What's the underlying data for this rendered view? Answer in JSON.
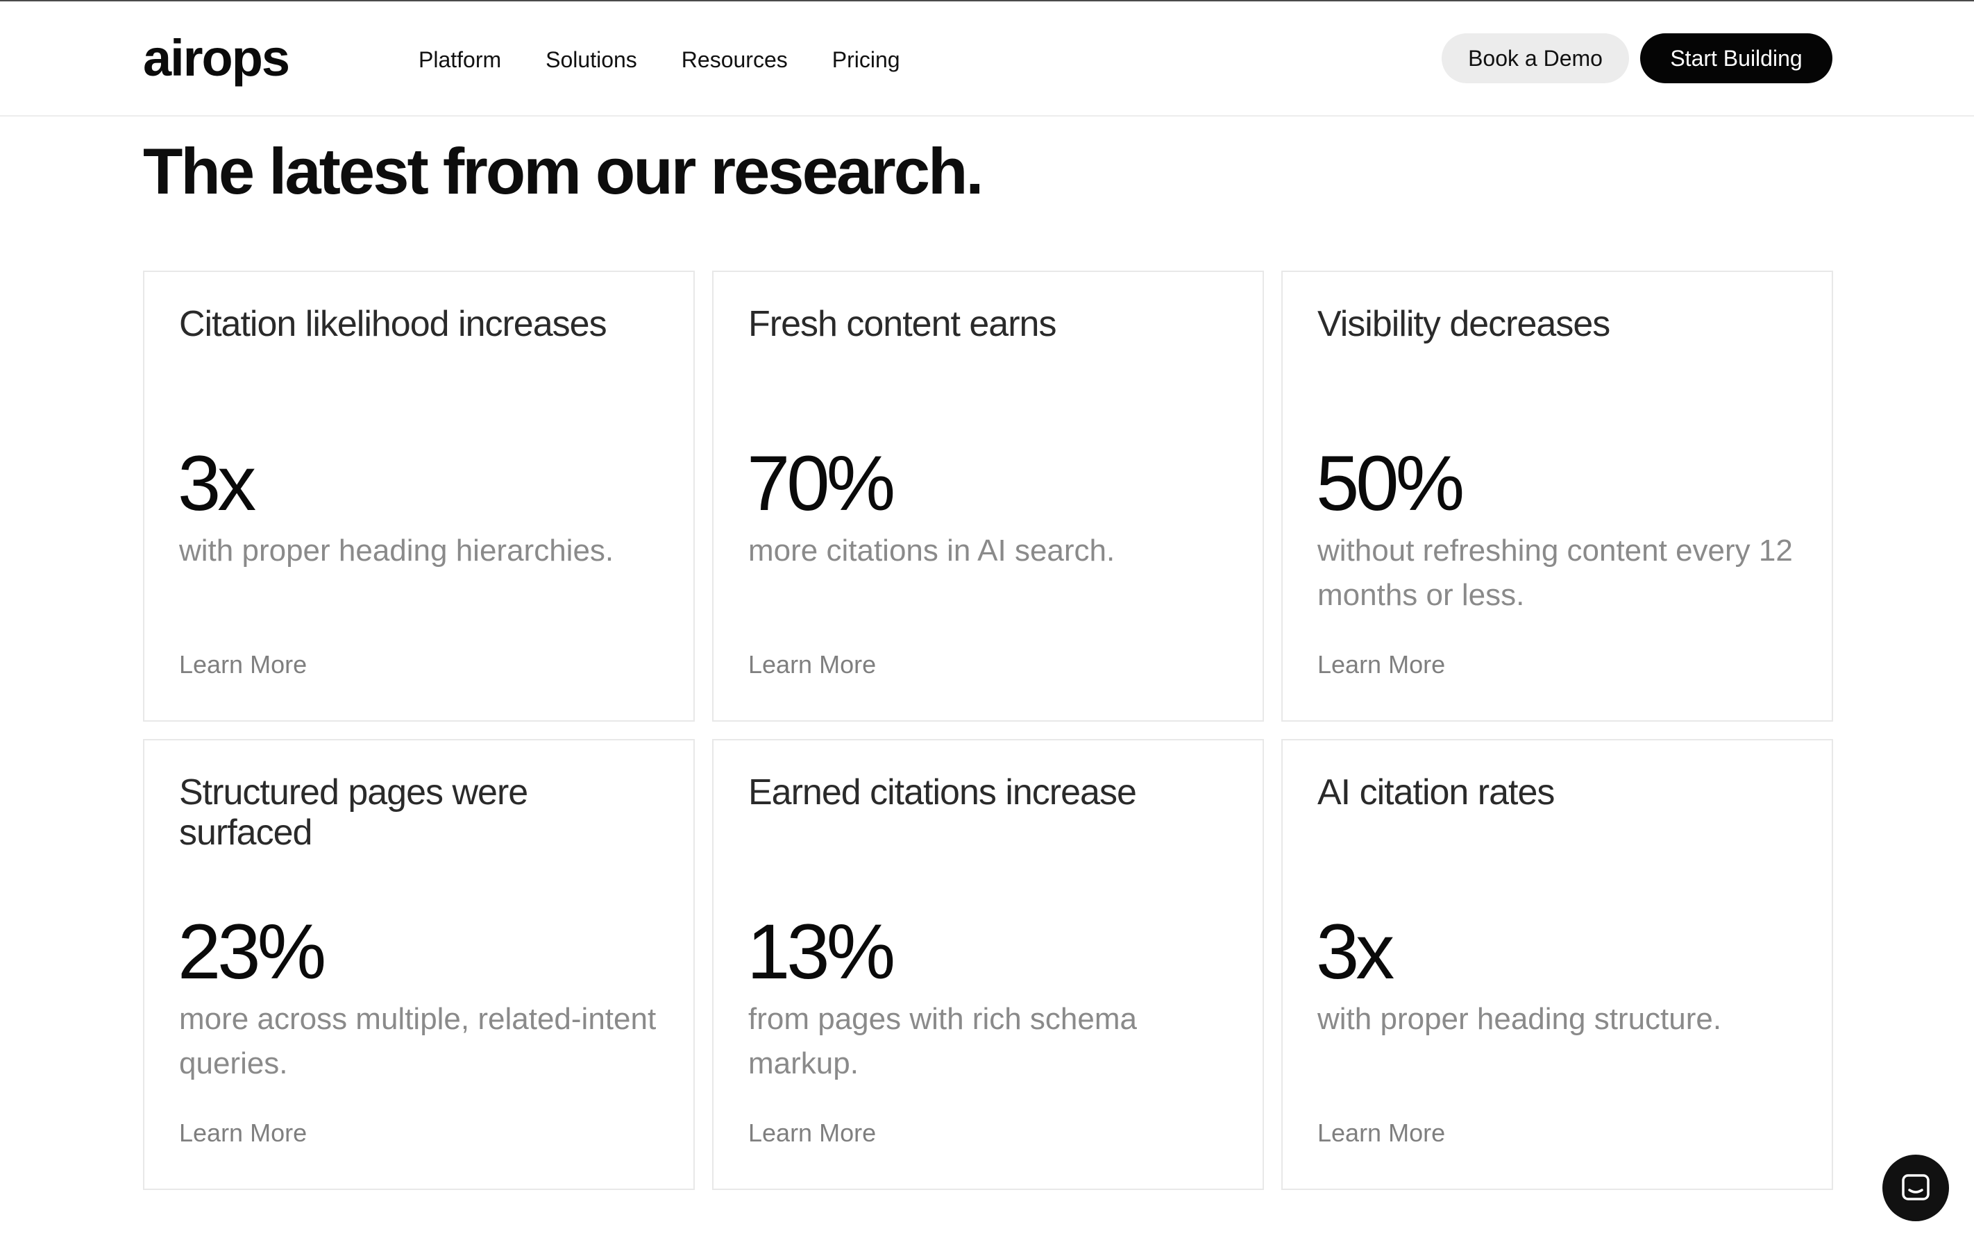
{
  "brand": {
    "logo_text": "airops"
  },
  "nav": {
    "links": [
      "Platform",
      "Solutions",
      "Resources",
      "Pricing"
    ],
    "book_demo_label": "Book a Demo",
    "start_building_label": "Start Building"
  },
  "section": {
    "title": "The latest from our research."
  },
  "cards": [
    {
      "title": "Citation likelihood increases",
      "stat": "3x",
      "desc": "with proper heading hierarchies.",
      "link": "Learn More"
    },
    {
      "title": "Fresh content earns",
      "stat": "70%",
      "desc": "more citations in AI search.",
      "link": "Learn More"
    },
    {
      "title": "Visibility decreases",
      "stat": "50%",
      "desc": "without refreshing content every 12 months or less.",
      "link": "Learn More"
    },
    {
      "title": "Structured pages were surfaced",
      "stat": "23%",
      "desc": "more across multiple, related-intent queries.",
      "link": "Learn More"
    },
    {
      "title": "Earned citations increase",
      "stat": "13%",
      "desc": "from pages with rich schema markup.",
      "link": "Learn More"
    },
    {
      "title": "AI citation rates",
      "stat": "3x",
      "desc": "with proper heading structure.",
      "link": "Learn More"
    }
  ],
  "chat": {
    "icon": "chat-icon"
  },
  "colors": {
    "primary_button": "#050505",
    "secondary_button": "#ececec",
    "muted_text": "#8a8a8a"
  }
}
